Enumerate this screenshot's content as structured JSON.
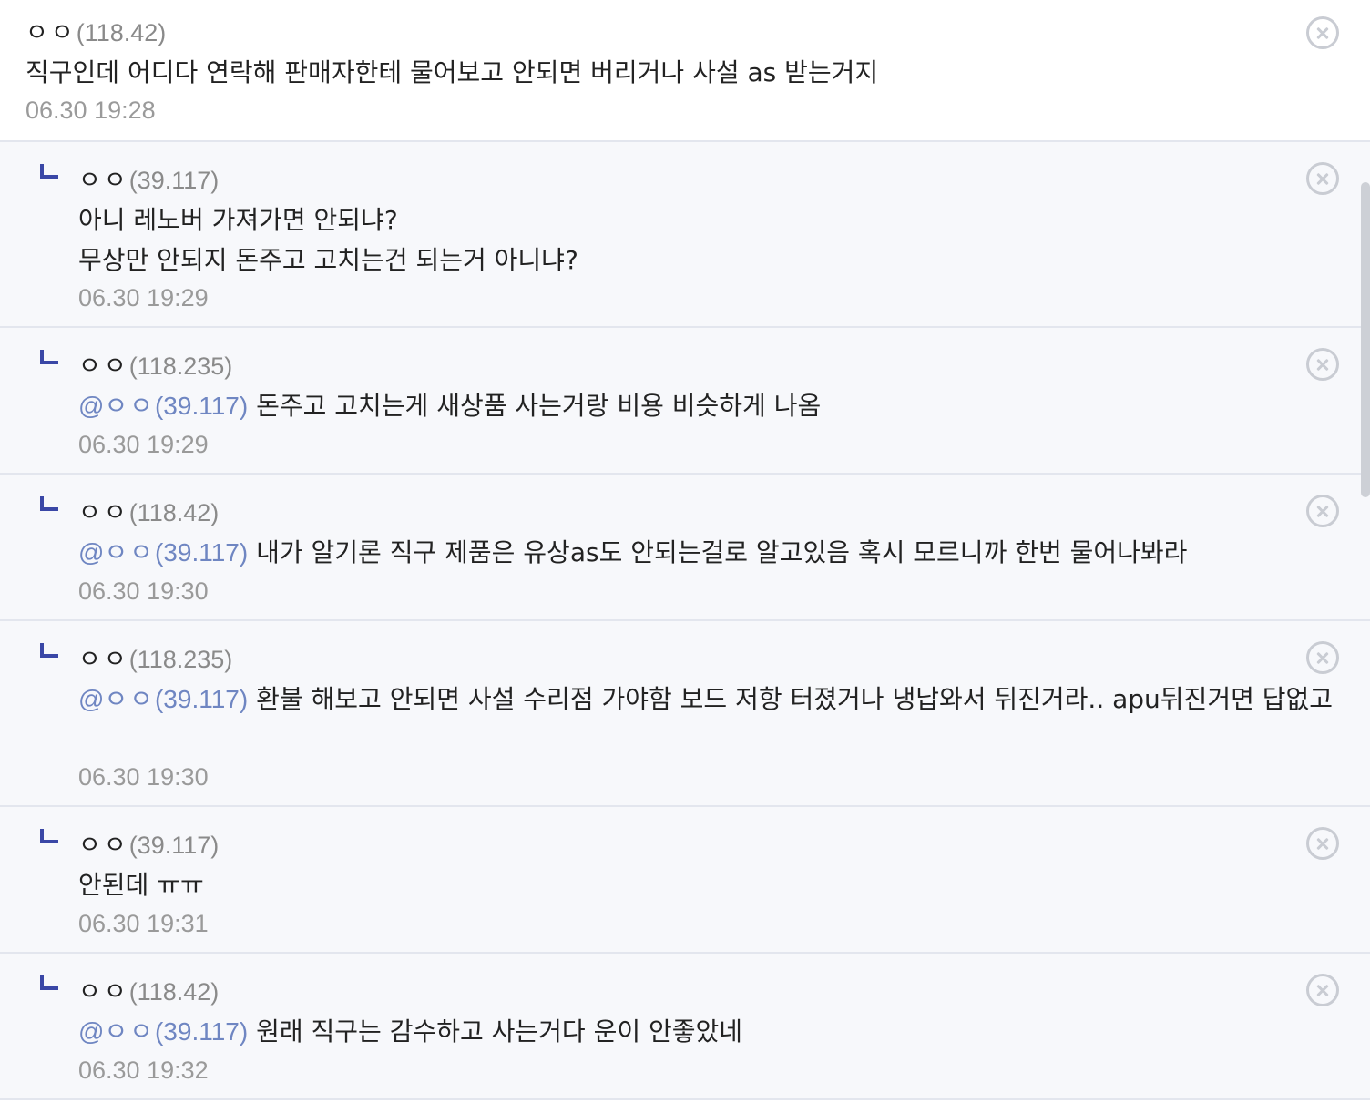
{
  "comments": [
    {
      "nick": "ㅇㅇ",
      "ip": "(118.42)",
      "mention": null,
      "lines": [
        "직구인데 어디다 연락해 판매자한테 물어보고 안되면 버리거나 사설 as 받는거지"
      ],
      "date": "06.30 19:28"
    },
    {
      "nick": "ㅇㅇ",
      "ip": "(39.117)",
      "mention": null,
      "lines": [
        "아니 레노버 가져가면 안되냐?",
        "무상만 안되지 돈주고 고치는건 되는거 아니냐?"
      ],
      "date": "06.30 19:29"
    },
    {
      "nick": "ㅇㅇ",
      "ip": "(118.235)",
      "mention": {
        "at": "@",
        "nick": "ㅇㅇ",
        "ip": "(39.117)"
      },
      "text": "돈주고 고치는게 새상품 사는거랑 비용 비슷하게 나옴",
      "date": "06.30 19:29"
    },
    {
      "nick": "ㅇㅇ",
      "ip": "(118.42)",
      "mention": {
        "at": "@",
        "nick": "ㅇㅇ",
        "ip": "(39.117)"
      },
      "text": "내가 알기론 직구 제품은 유상as도 안되는걸로 알고있음 혹시 모르니까 한번 물어나봐라",
      "date": "06.30 19:30"
    },
    {
      "nick": "ㅇㅇ",
      "ip": "(118.235)",
      "mention": {
        "at": "@",
        "nick": "ㅇㅇ",
        "ip": "(39.117)"
      },
      "text": "환불 해보고 안되면 사설 수리점 가야함 보드 저항 터졌거나 냉납와서 뒤진거라.. apu뒤진거면 답없고",
      "date": "06.30 19:30"
    },
    {
      "nick": "ㅇㅇ",
      "ip": "(39.117)",
      "mention": null,
      "lines": [
        "안된데 ㅠㅠ"
      ],
      "date": "06.30 19:31"
    },
    {
      "nick": "ㅇㅇ",
      "ip": "(118.42)",
      "mention": {
        "at": "@",
        "nick": "ㅇㅇ",
        "ip": "(39.117)"
      },
      "text": "원래 직구는 감수하고 사는거다 운이 안좋았네",
      "date": "06.30 19:32"
    }
  ],
  "icons": {
    "delete": "close-circle-icon",
    "reply": "reply-corner-icon"
  },
  "colors": {
    "reply_marker": "#3a47a6",
    "mention": "#6f86c2",
    "meta": "#9a9a9a",
    "reply_bg": "#f7f8fb"
  }
}
